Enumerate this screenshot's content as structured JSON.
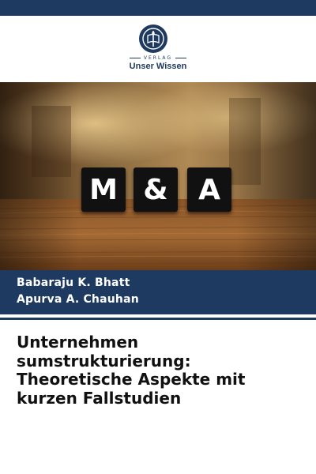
{
  "publisher": {
    "imprint": "VERLAG",
    "name": "Unser Wissen"
  },
  "cover_image": {
    "tiles": [
      "M",
      "&",
      "A"
    ]
  },
  "authors": [
    "Babaraju K. Bhatt",
    "Apurva A. Chauhan"
  ],
  "title_lines": [
    "Unternehmen",
    "sumstrukturierung:",
    "Theoretische Aspekte mit",
    "kurzen Fallstudien"
  ],
  "colors": {
    "brand_navy": "#1f3a60",
    "tile_black": "#111111",
    "title_text": "#111111"
  }
}
